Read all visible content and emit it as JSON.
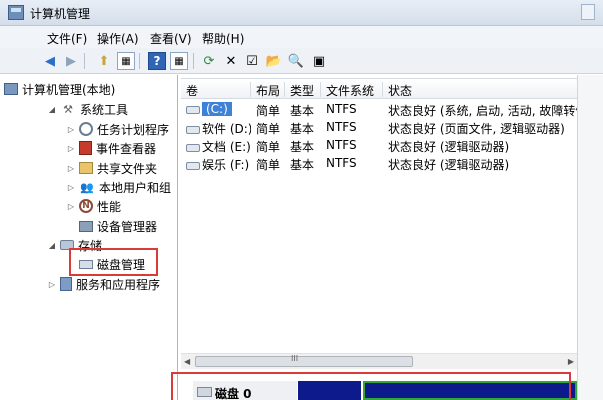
{
  "window": {
    "title": "计算机管理"
  },
  "menu": [
    "文件(F)",
    "操作(A)",
    "查看(V)",
    "帮助(H)"
  ],
  "tree": {
    "root": "计算机管理(本地)",
    "system_tools": "系统工具",
    "task_scheduler": "任务计划程序",
    "event_viewer": "事件查看器",
    "shared_folders": "共享文件夹",
    "local_users": "本地用户和组",
    "performance": "性能",
    "device_manager": "设备管理器",
    "storage": "存储",
    "disk_management": "磁盘管理",
    "services": "服务和应用程序"
  },
  "table": {
    "headers": [
      "卷",
      "布局",
      "类型",
      "文件系统",
      "状态"
    ],
    "rows": [
      {
        "volume": "(C:)",
        "layout": "简单",
        "type": "基本",
        "fs": "NTFS",
        "status": "状态良好 (系统, 启动, 活动, 故障转储"
      },
      {
        "volume": "软件 (D:)",
        "layout": "简单",
        "type": "基本",
        "fs": "NTFS",
        "status": "状态良好 (页面文件, 逻辑驱动器)"
      },
      {
        "volume": "文档 (E:)",
        "layout": "简单",
        "type": "基本",
        "fs": "NTFS",
        "status": "状态良好 (逻辑驱动器)"
      },
      {
        "volume": "娱乐 (F:)",
        "layout": "简单",
        "type": "基本",
        "fs": "NTFS",
        "status": "状态良好 (逻辑驱动器)"
      }
    ]
  },
  "scrollbar_grip": "III",
  "disk_panel": {
    "label": "磁盘 0"
  },
  "colors": {
    "highlight": "#d93a3a",
    "selected_row": "#3d82d6",
    "partition": "#0c1a8c",
    "partition_selected": "#2fa83a"
  }
}
